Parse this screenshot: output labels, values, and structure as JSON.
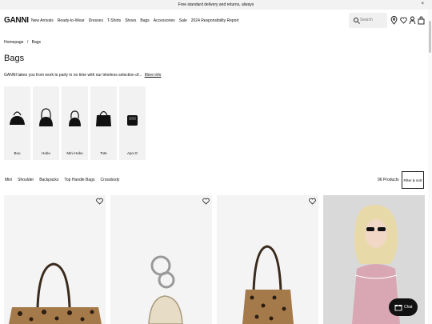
{
  "announcement": {
    "text": "Free standard delivery and returns, always",
    "close": "×"
  },
  "header": {
    "logo": "GANNI",
    "nav": [
      "New Arrivals",
      "Ready-to-Wear",
      "Dresses",
      "T-Shirts",
      "Shoes",
      "Bags",
      "Accessories",
      "Sale",
      "2024 Responsibility Report"
    ],
    "search_placeholder": "Search"
  },
  "breadcrumb": {
    "home": "Homepage",
    "sep": "/",
    "current": "Bags"
  },
  "page_title": "Bags",
  "intro": {
    "text": "GANNI takes you from work to party in no time with our timeless selection of...",
    "more": "More info"
  },
  "categories": [
    "Bou",
    "Hobo",
    "Mini Hobo",
    "Tote",
    "Apo-G"
  ],
  "filters": [
    "Mini",
    "Shoulder",
    "Backpacks",
    "Top Handle Bags",
    "Crossbody"
  ],
  "product_count": "96 Products",
  "filter_sort": "Filter & sort",
  "chat_label": "Chat",
  "colors": {
    "accent": "#111111",
    "panel": "#f2f2f2",
    "leopard": "#a57a4b"
  }
}
